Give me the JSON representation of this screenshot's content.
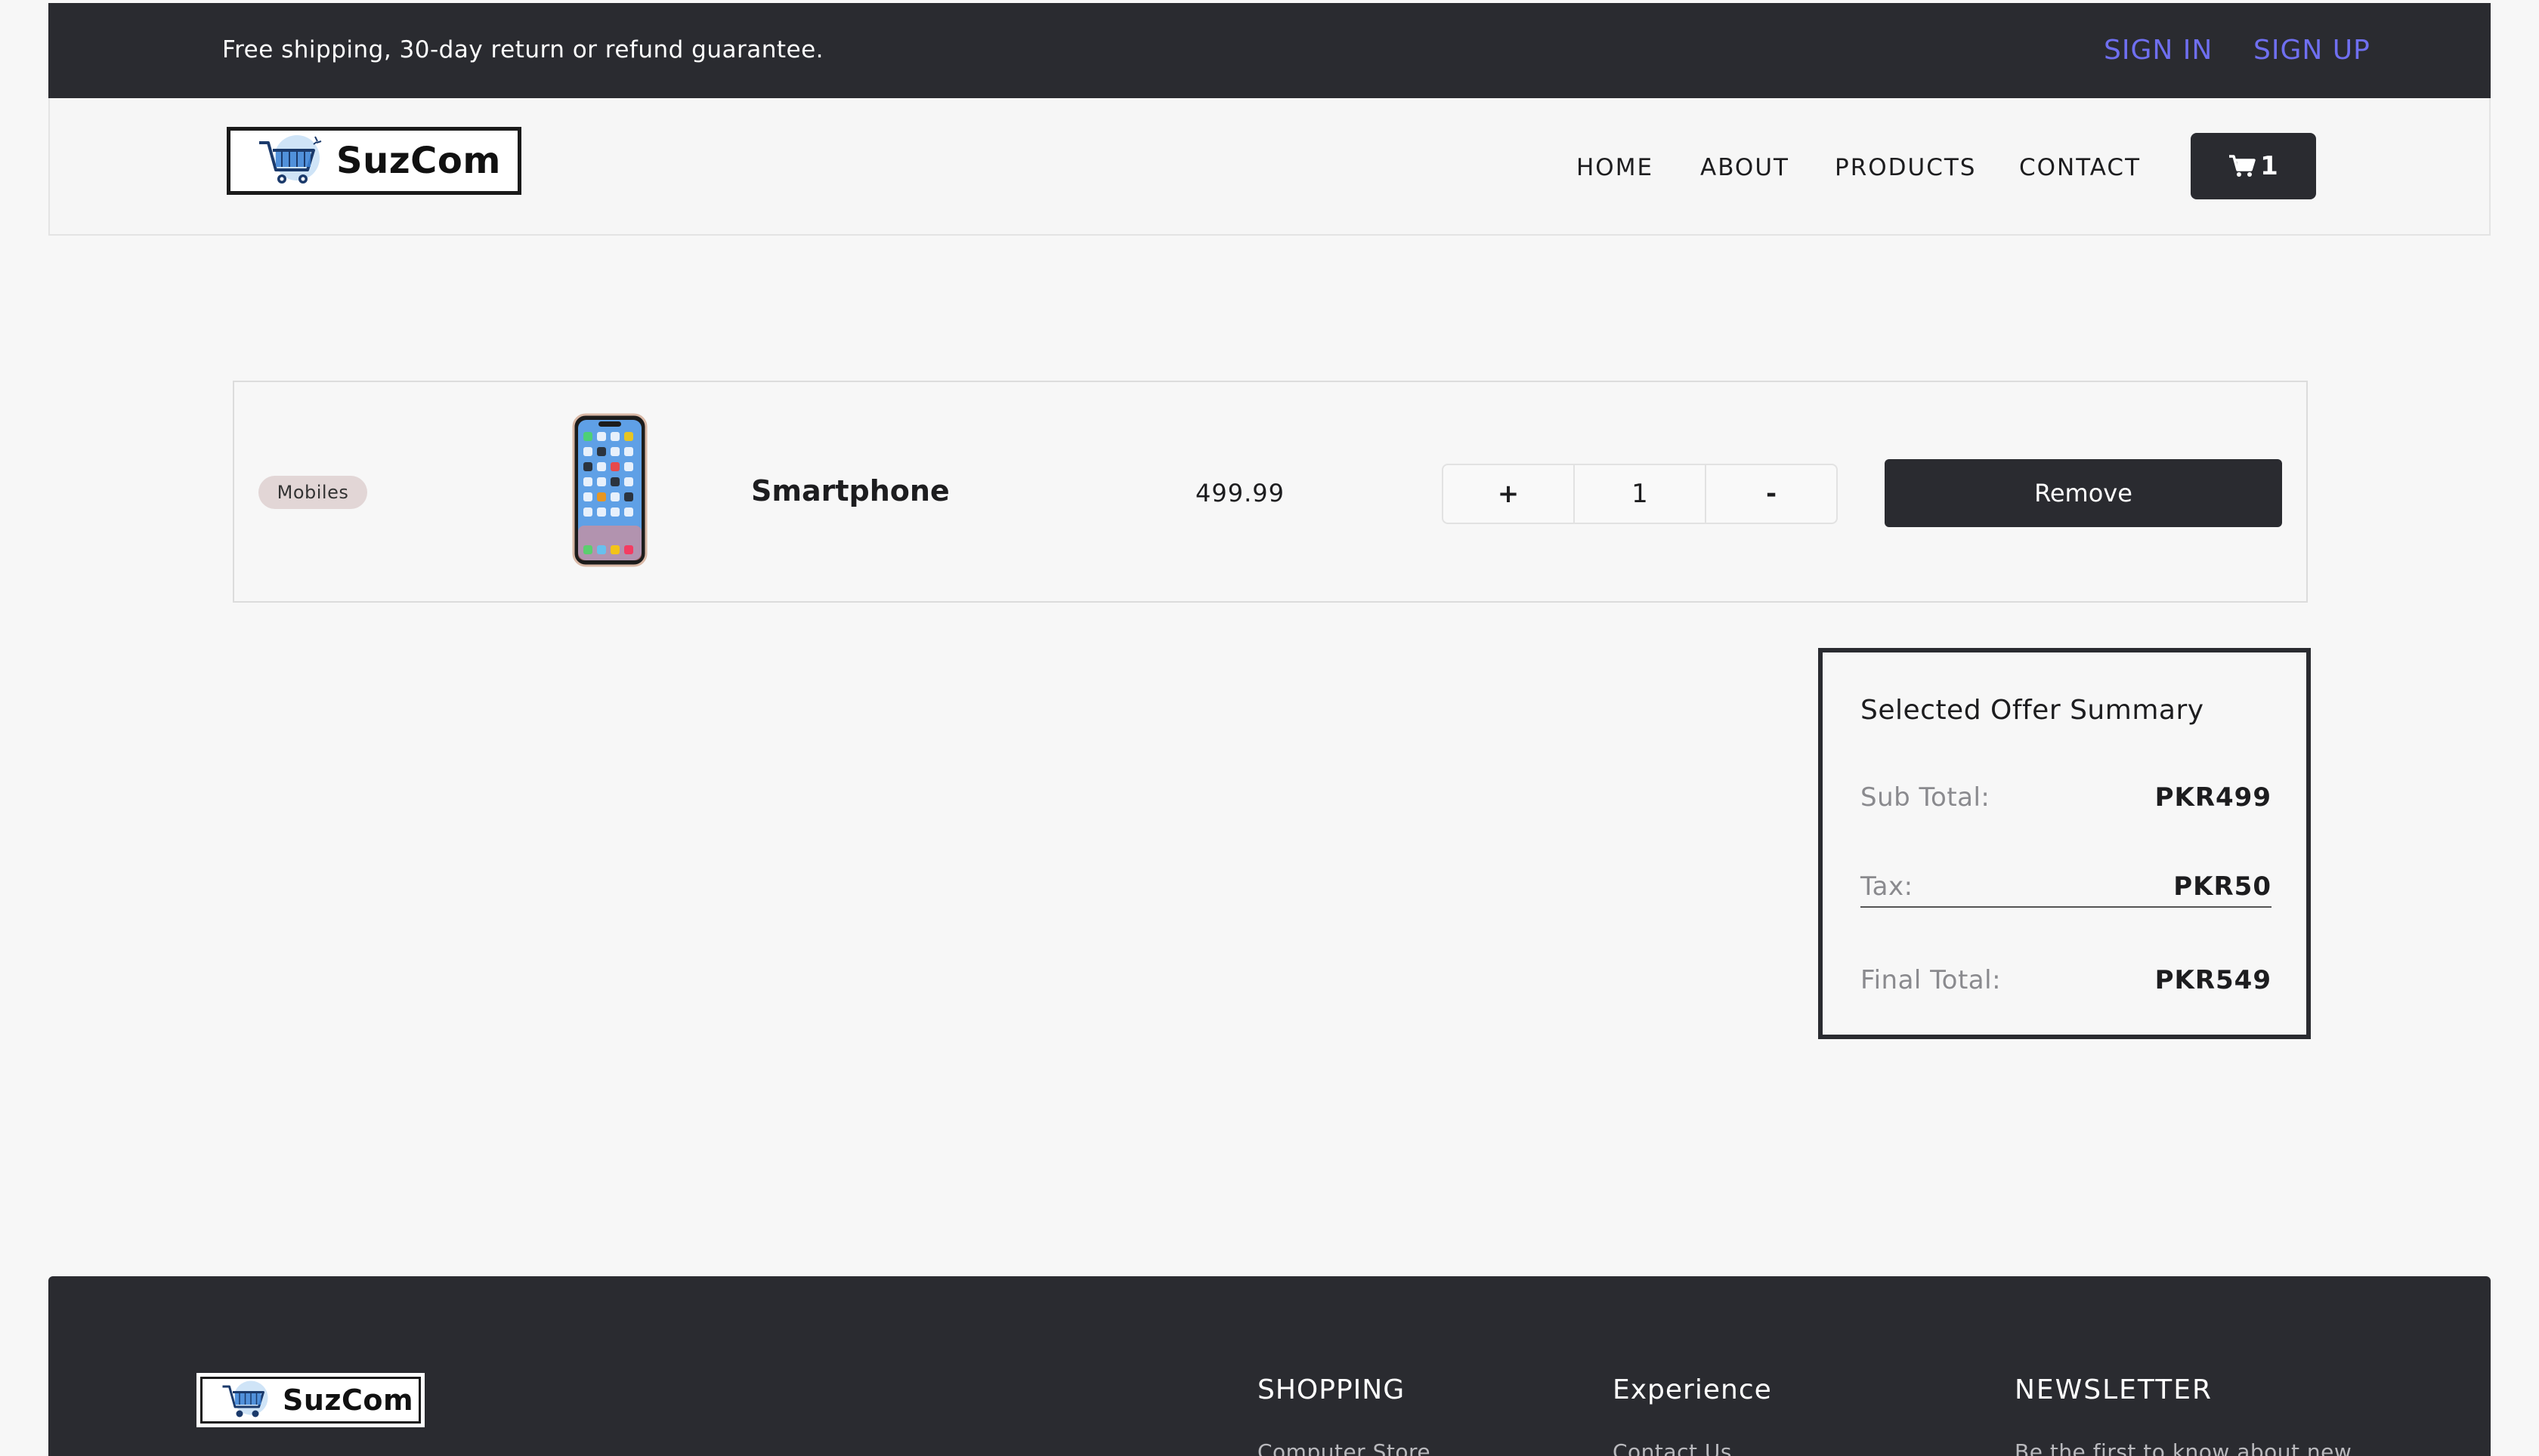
{
  "topbar": {
    "promo_text": "Free shipping, 30-day return or refund guarantee.",
    "sign_in": "SIGN IN",
    "sign_up": "SIGN UP"
  },
  "header": {
    "logo_text": "SuzCom",
    "nav": {
      "home": "HOME",
      "about": "ABOUT",
      "products": "PRODUCTS",
      "contact": "CONTACT"
    },
    "cart_count": "1"
  },
  "cart": {
    "items": [
      {
        "category": "Mobiles",
        "name": "Smartphone",
        "price": "499.99",
        "quantity": "1",
        "plus_label": "+",
        "minus_label": "-",
        "remove_label": "Remove"
      }
    ]
  },
  "summary": {
    "title": "Selected Offer Summary",
    "sub_total_label": "Sub Total:",
    "sub_total_value": "PKR499",
    "tax_label": "Tax:",
    "tax_value": "PKR50",
    "final_total_label": "Final Total:",
    "final_total_value": "PKR549"
  },
  "footer": {
    "logo_text": "SuzCom",
    "headings": {
      "shopping": "SHOPPING",
      "experience": "Experience",
      "newsletter": "NEWSLETTER"
    },
    "links": {
      "shopping_first": "Computer Store",
      "experience_first": "Contact Us",
      "newsletter_text": "Be the first to know about new"
    }
  },
  "colors": {
    "dark": "#2a2b30",
    "accent_link": "#6f6ff0",
    "badge_bg": "#e2d6d6",
    "page_bg": "#f7f7f7"
  },
  "icons": {
    "cart": "shopping-cart-icon",
    "logo": "shopping-cart-logo-icon"
  }
}
